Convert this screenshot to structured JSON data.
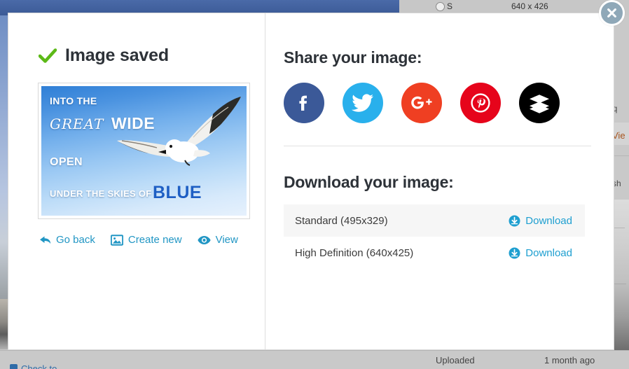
{
  "background": {
    "topbar": {
      "radio_label": "S",
      "dimensions": "640 x 426"
    },
    "right_column": {
      "req_fragment": "req",
      "view_fragment": "Vie",
      "sh_fragment": "sh"
    },
    "bottom": {
      "uploaded_label": "Uploaded",
      "uploaded_time": "1 month ago",
      "checkbox_link": "Check to ..."
    }
  },
  "modal": {
    "close_label": "×",
    "left": {
      "saved_title": "Image saved",
      "check_icon": "green-check-icon",
      "preview": {
        "line_into": "INTO THE",
        "line_great": "GREAT",
        "line_wide": "WIDE",
        "line_open": "OPEN",
        "line_under": "UNDER THE SKIES OF",
        "line_blue": "BLUE"
      },
      "actions": [
        {
          "label": "Go back",
          "icon": "back-arrow-icon"
        },
        {
          "label": "Create new",
          "icon": "image-icon"
        },
        {
          "label": "View",
          "icon": "eye-icon"
        }
      ]
    },
    "right": {
      "share_title": "Share your image:",
      "social": [
        {
          "name": "facebook",
          "glyph": "f",
          "color": "#3b5998"
        },
        {
          "name": "twitter",
          "glyph": "t",
          "color": "#29b0ec"
        },
        {
          "name": "googleplus",
          "glyph": "g+",
          "color": "#ef3f22"
        },
        {
          "name": "pinterest",
          "glyph": "p",
          "color": "#e6041b"
        },
        {
          "name": "buffer",
          "glyph": "b",
          "color": "#000000"
        }
      ],
      "download_title": "Download your image:",
      "downloads": [
        {
          "label": "Standard (495x329)",
          "action": "Download"
        },
        {
          "label": "High Definition (640x425)",
          "action": "Download"
        }
      ]
    }
  },
  "colors": {
    "link": "#2196c4",
    "download_link": "#1e9fd0",
    "heading": "#2d3238",
    "check_green": "#5cb917",
    "close_circle": "#8fa8b8"
  }
}
